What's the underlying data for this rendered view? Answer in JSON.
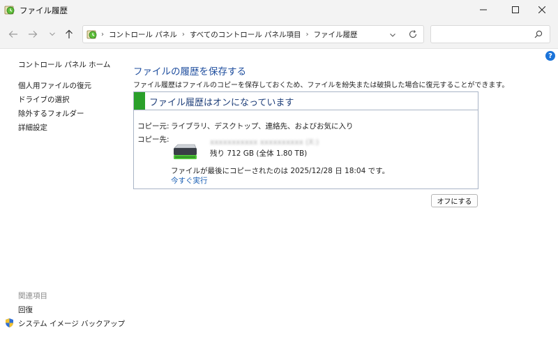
{
  "window": {
    "title": "ファイル履歴"
  },
  "address_bar": {
    "crumbs": [
      "コントロール パネル",
      "すべてのコントロール パネル項目",
      "ファイル履歴"
    ]
  },
  "search": {
    "placeholder": "",
    "value": ""
  },
  "help": {
    "label": "?"
  },
  "sidebar": {
    "home": "コントロール パネル ホーム",
    "links": [
      "個人用ファイルの復元",
      "ドライブの選択",
      "除外するフォルダー",
      "詳細設定"
    ],
    "related_heading": "関連項目",
    "related_links": [
      "回復",
      "システム イメージ バックアップ"
    ]
  },
  "main": {
    "title": "ファイルの履歴を保存する",
    "description": "ファイル履歴はファイルのコピーを保存しておくため、ファイルを紛失または破損した場合に復元することができます。",
    "panel": {
      "status_title": "ファイル履歴はオンになっています",
      "source_label": "コピー元:",
      "source_value": "ライブラリ、デスクトップ、連絡先、およびお気に入り",
      "dest_label": "コピー先:",
      "drive_name": "xxxxxxxxxxx xxxxxxxxxx (X:)",
      "drive_free": "残り 712 GB (全体 1.80 TB)",
      "last_copy": "ファイルが最後にコピーされたのは 2025/12/28 日 18:04 です。",
      "run_now": "今すぐ実行"
    },
    "off_button": "オフにする"
  },
  "colors": {
    "accent_title": "#1f4e9e",
    "link": "#1a5fb4",
    "status_on": "#2aa02a",
    "panel_border": "#a9b4c6"
  }
}
